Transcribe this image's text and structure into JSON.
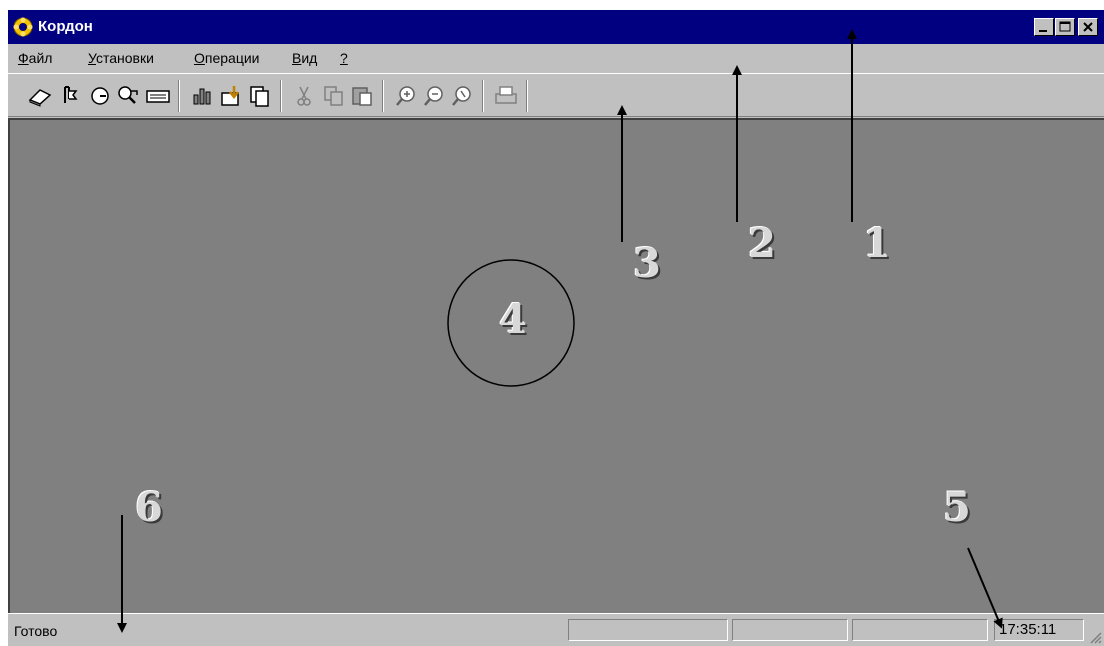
{
  "window": {
    "title": "Кордон",
    "controls": [
      "minimize-icon",
      "maximize-icon",
      "close-icon"
    ]
  },
  "menu": {
    "items": [
      {
        "ul": "Ф",
        "rest": "айл"
      },
      {
        "ul": "У",
        "rest": "становки"
      },
      {
        "ul": "О",
        "rest": "перации"
      },
      {
        "ul": "В",
        "rest": "ид"
      },
      {
        "ul": "?",
        "rest": ""
      }
    ]
  },
  "toolbar": {
    "icons": [
      "eraser-icon",
      "pin-icon",
      "clock-icon",
      "search-key-icon",
      "keyboard-icon",
      "equalizer-icon",
      "export-icon",
      "copy-pages-icon",
      "cut-icon",
      "copy-icon",
      "paste-icon",
      "zoom-in-icon",
      "zoom-out-icon",
      "zoom-reset-icon",
      "print-icon"
    ]
  },
  "status": {
    "text": "Готово",
    "clock": "17:35:11"
  },
  "callouts": {
    "labels": [
      "1",
      "2",
      "3",
      "4",
      "5",
      "6"
    ]
  }
}
